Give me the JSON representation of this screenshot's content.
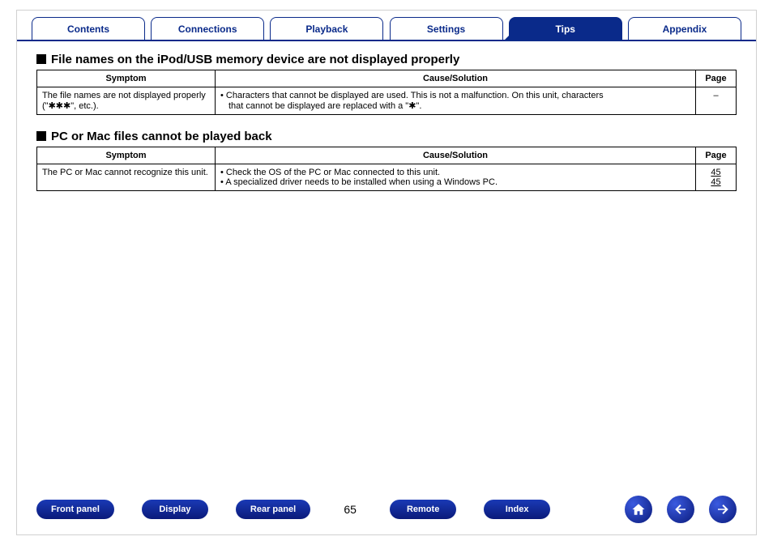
{
  "tabs": {
    "contents": "Contents",
    "connections": "Connections",
    "playback": "Playback",
    "settings": "Settings",
    "tips": "Tips",
    "appendix": "Appendix",
    "active": 4
  },
  "section1": {
    "title": "File names on the iPod/USB memory device are not displayed properly",
    "headers": {
      "symptom": "Symptom",
      "cause": "Cause/Solution",
      "page": "Page"
    },
    "row1": {
      "symptom": "The file names are not displayed properly (\"✱✱✱\", etc.).",
      "cause_line1": "Characters that cannot be displayed are used. This is not a malfunction. On this unit, characters",
      "cause_line2": "that cannot be displayed are replaced with a \"✱\".",
      "page": "–"
    }
  },
  "section2": {
    "title": "PC or Mac files cannot be played back",
    "headers": {
      "symptom": "Symptom",
      "cause": "Cause/Solution",
      "page": "Page"
    },
    "row1": {
      "symptom": "The PC or Mac cannot recognize this unit.",
      "cause1": "Check the OS of the PC or Mac connected to this unit.",
      "cause2": "A specialized driver needs to be installed when using a Windows PC.",
      "page1": "45",
      "page2": "45"
    }
  },
  "footer": {
    "front_panel": "Front panel",
    "display": "Display",
    "rear_panel": "Rear panel",
    "page_number": "65",
    "remote": "Remote",
    "index": "Index"
  }
}
